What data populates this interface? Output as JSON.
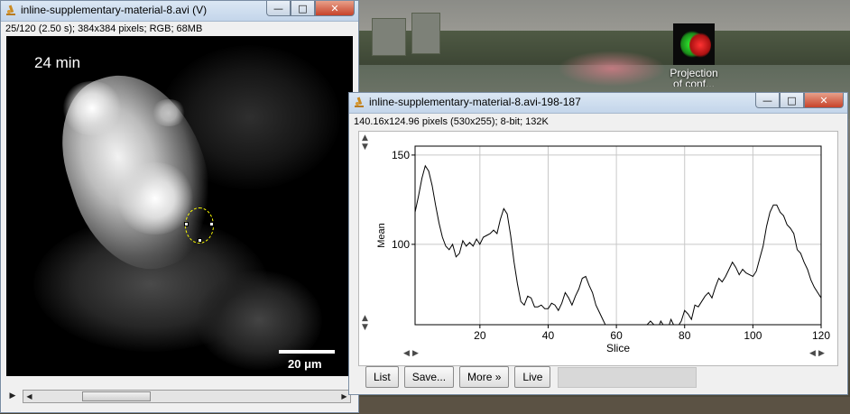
{
  "image_window": {
    "title": "inline-supplementary-material-8.avi (V)",
    "subtitle": "25/120 (2.50 s); 384x384 pixels; RGB; 68MB",
    "timestamp": "24 min",
    "scale_label": "20 μm",
    "controls": {
      "minimize": "—",
      "maximize": "□",
      "close": "✕"
    },
    "scrollbar": {
      "play": "▶",
      "left": "◀",
      "right": "▶",
      "position_fraction": 0.2
    }
  },
  "desktop_icon": {
    "label_line1": "Projection",
    "label_line2": "of conf..."
  },
  "plot_window": {
    "title": "inline-supplementary-material-8.avi-198-187",
    "subtitle": "140.16x124.96 pixels (530x255); 8-bit; 132K",
    "controls": {
      "minimize": "—",
      "maximize": "□",
      "close": "✕"
    },
    "buttons": {
      "list": "List",
      "save": "Save...",
      "more": "More »",
      "live": "Live"
    },
    "spinners": {
      "up": "▲",
      "down": "▼",
      "left": "◀",
      "right": "▶"
    }
  },
  "chart_data": {
    "type": "line",
    "xlabel": "Slice",
    "ylabel": "Mean",
    "xlim": [
      1,
      120
    ],
    "ylim": [
      55,
      155
    ],
    "xticks": [
      20,
      40,
      60,
      80,
      100,
      120
    ],
    "yticks": [
      100,
      150
    ],
    "grid": true,
    "series": [
      {
        "x": [
          1,
          2,
          3,
          4,
          5,
          6,
          7,
          8,
          9,
          10,
          11,
          12,
          13,
          14,
          15,
          16,
          17,
          18,
          19,
          20,
          21,
          22,
          23,
          24,
          25,
          26,
          27,
          28,
          29,
          30,
          31,
          32,
          33,
          34,
          35,
          36,
          37,
          38,
          39,
          40,
          41,
          42,
          43,
          44,
          45,
          46,
          47,
          48,
          49,
          50,
          51,
          52,
          53,
          54,
          55,
          56,
          57,
          58,
          59,
          60,
          61,
          62,
          63,
          64,
          65,
          66,
          67,
          68,
          69,
          70,
          71,
          72,
          73,
          74,
          75,
          76,
          77,
          78,
          79,
          80,
          81,
          82,
          83,
          84,
          85,
          86,
          87,
          88,
          89,
          90,
          91,
          92,
          93,
          94,
          95,
          96,
          97,
          98,
          99,
          100,
          101,
          102,
          103,
          104,
          105,
          106,
          107,
          108,
          109,
          110,
          111,
          112,
          113,
          114,
          115,
          116,
          117,
          118,
          119,
          120
        ],
        "y": [
          118,
          127,
          137,
          144,
          141,
          133,
          122,
          112,
          104,
          99,
          97,
          100,
          93,
          95,
          102,
          99,
          101,
          99,
          103,
          100,
          104,
          105,
          106,
          108,
          106,
          114,
          120,
          117,
          105,
          90,
          78,
          68,
          66,
          71,
          70,
          65,
          65,
          66,
          64,
          64,
          67,
          66,
          63,
          67,
          73,
          70,
          66,
          71,
          75,
          81,
          82,
          77,
          73,
          66,
          62,
          58,
          54,
          47,
          48,
          45,
          47,
          47,
          48,
          44,
          45,
          43,
          45,
          48,
          55,
          57,
          55,
          52,
          57,
          54,
          52,
          58,
          54,
          54,
          57,
          63,
          61,
          58,
          66,
          65,
          68,
          71,
          73,
          70,
          76,
          81,
          79,
          82,
          86,
          90,
          87,
          83,
          86,
          84,
          83,
          82,
          85,
          92,
          99,
          110,
          118,
          122,
          122,
          118,
          116,
          111,
          109,
          106,
          97,
          95,
          90,
          86,
          80,
          76,
          73,
          70
        ]
      }
    ]
  }
}
